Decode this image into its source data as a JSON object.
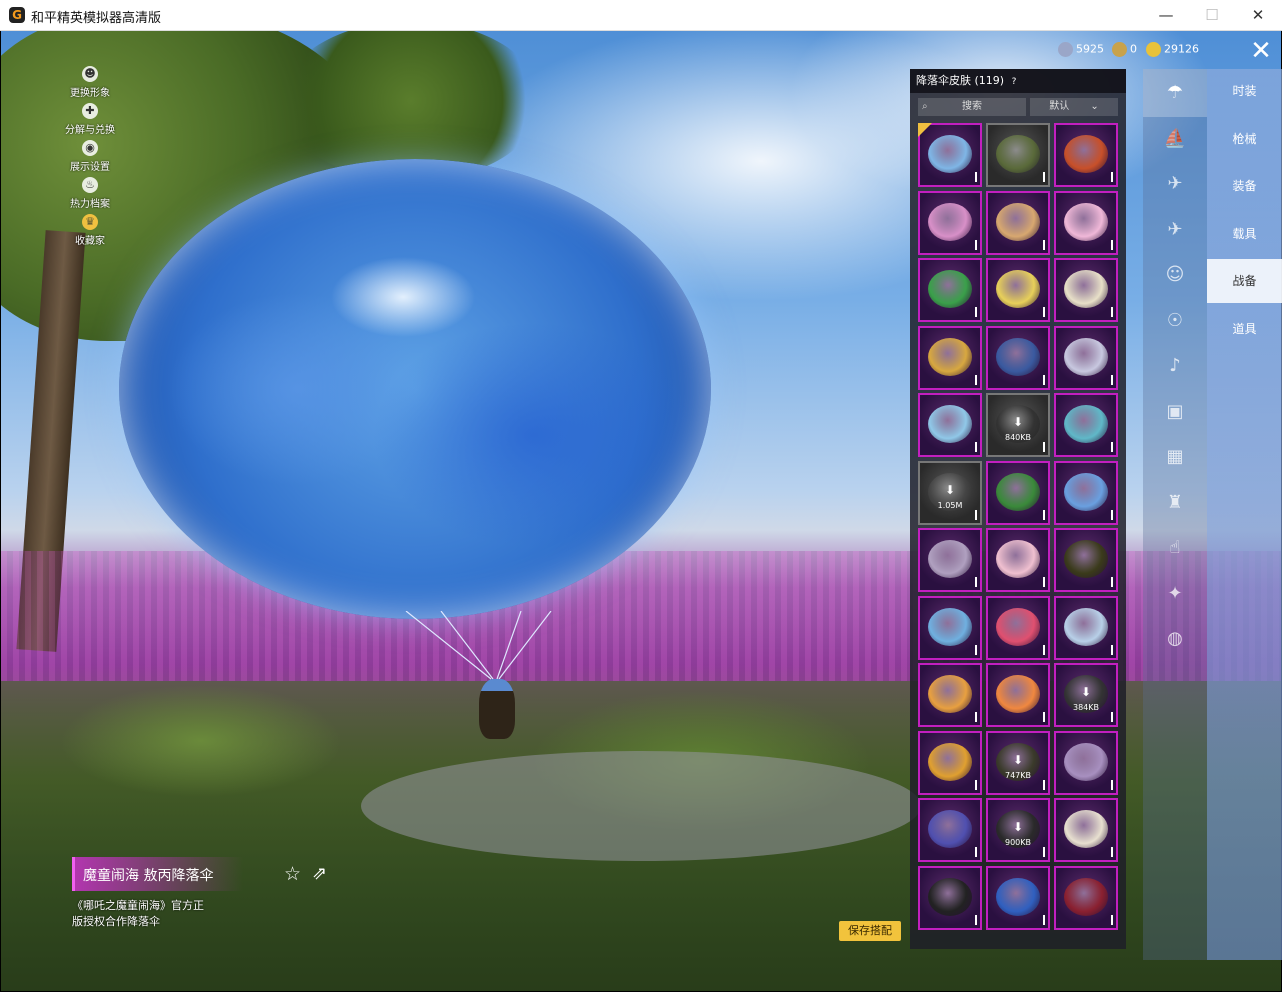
{
  "window": {
    "title": "和平精英模拟器高清版",
    "min": "—",
    "max": "☐",
    "close": "✕"
  },
  "currency": [
    {
      "icon": "coin-icon",
      "value": "5925",
      "color": "#9aa6c8"
    },
    {
      "icon": "token-icon",
      "value": "0",
      "color": "#c9a24a"
    },
    {
      "icon": "gold-icon",
      "value": "29126",
      "color": "#e8c23a"
    }
  ],
  "left_menu": [
    {
      "label": "更换形象",
      "icon": "person-icon",
      "glyph": "☻"
    },
    {
      "label": "分解与兑换",
      "icon": "puzzle-icon",
      "glyph": "✚"
    },
    {
      "label": "展示设置",
      "icon": "eye-icon",
      "glyph": "◉"
    },
    {
      "label": "热力档案",
      "icon": "flame-icon",
      "glyph": "♨"
    },
    {
      "label": "收藏家",
      "icon": "collector-icon",
      "glyph": "♛"
    }
  ],
  "item": {
    "name": "魔童闹海 敖丙降落伞",
    "description": "《哪吒之魔童闹海》官方正版授权合作降落伞",
    "save_label": "保存搭配"
  },
  "panel": {
    "title": "降落伞皮肤 (119)",
    "help": "?",
    "search_placeholder": "搜索",
    "sort_label": "默认",
    "cells": [
      {
        "color": "#7fb6e6",
        "selected": true
      },
      {
        "color": "#5a6a3a",
        "gray": true
      },
      {
        "color": "#c8502a"
      },
      {
        "color": "#d890c8"
      },
      {
        "color": "#d8a870"
      },
      {
        "color": "#f0b8d8"
      },
      {
        "color": "#3aa04a"
      },
      {
        "color": "#e8d05a"
      },
      {
        "color": "#e8e0c8"
      },
      {
        "color": "#d8a840"
      },
      {
        "color": "#3a5aa0"
      },
      {
        "color": "#c8c8e0"
      },
      {
        "color": "#90c8e8"
      },
      {
        "color": "#333333",
        "gray": true,
        "download": "840KB"
      },
      {
        "color": "#60b8c8"
      },
      {
        "color": "#444444",
        "gray": true,
        "download": "1.05M"
      },
      {
        "color": "#3a8a3a"
      },
      {
        "color": "#6aa0e0"
      },
      {
        "color": "#b0a0c0"
      },
      {
        "color": "#f0c0d0"
      },
      {
        "color": "#3a3a1a"
      },
      {
        "color": "#70b0e0"
      },
      {
        "color": "#e05070"
      },
      {
        "color": "#b8d0e8"
      },
      {
        "color": "#e8a040"
      },
      {
        "color": "#f08840"
      },
      {
        "color": "#333333",
        "download": "384KB"
      },
      {
        "color": "#e0a030"
      },
      {
        "color": "#3a3a2a",
        "download": "747KB"
      },
      {
        "color": "#a890c0"
      },
      {
        "color": "#5050b0"
      },
      {
        "color": "#2a2a2a",
        "download": "900KB"
      },
      {
        "color": "#e8e0d0"
      },
      {
        "color": "#222222"
      },
      {
        "color": "#3060c0"
      },
      {
        "color": "#8a2030"
      }
    ]
  },
  "categories": [
    {
      "icon": "parachute-icon",
      "glyph": "☂"
    },
    {
      "icon": "boat-icon",
      "glyph": "⛵"
    },
    {
      "icon": "drone-icon",
      "glyph": "✈"
    },
    {
      "icon": "plane-icon",
      "glyph": "✈"
    },
    {
      "icon": "emote-icon",
      "glyph": "☺"
    },
    {
      "icon": "robot-icon",
      "glyph": "☉"
    },
    {
      "icon": "speaker-icon",
      "glyph": "♪"
    },
    {
      "icon": "chat-icon",
      "glyph": "▣"
    },
    {
      "icon": "photo-icon",
      "glyph": "▦"
    },
    {
      "icon": "spray-icon",
      "glyph": "♜"
    },
    {
      "icon": "hand-icon",
      "glyph": "☝"
    },
    {
      "icon": "wand-icon",
      "glyph": "✦"
    },
    {
      "icon": "ufo-icon",
      "glyph": "◍"
    }
  ],
  "tabs": [
    {
      "label": "时装"
    },
    {
      "label": "枪械"
    },
    {
      "label": "装备"
    },
    {
      "label": "载具"
    },
    {
      "label": "战备",
      "active": true
    },
    {
      "label": "道具"
    }
  ]
}
